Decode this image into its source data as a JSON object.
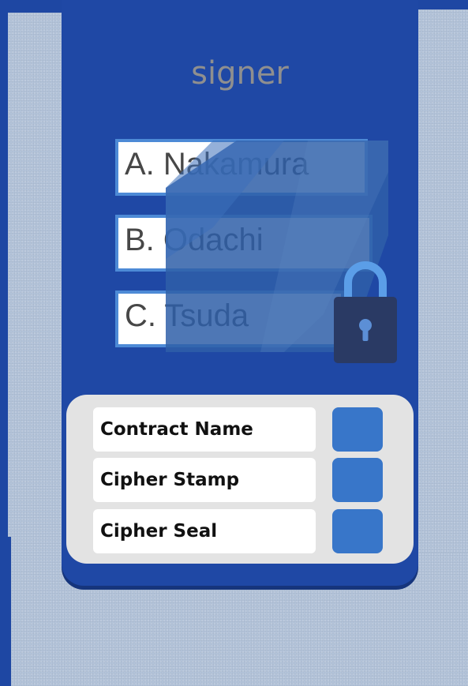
{
  "signer": {
    "title": "signer",
    "options": [
      {
        "label": "A. Nakamura"
      },
      {
        "label": "B. Odachi"
      },
      {
        "label": "C. Tsuda"
      }
    ]
  },
  "fields": {
    "items": [
      {
        "label": "Contract Name"
      },
      {
        "label": "Cipher Stamp"
      },
      {
        "label": "Cipher Seal"
      }
    ]
  },
  "icons": {
    "lock": "lock-icon"
  },
  "colors": {
    "card_blue": "#1f48a5",
    "button_blue": "#3876c9",
    "option_border": "#4d8ad6",
    "lock_body": "#2a3a64",
    "lock_shackle": "#5b9ee8",
    "background_texture": "#b3c3d9"
  }
}
